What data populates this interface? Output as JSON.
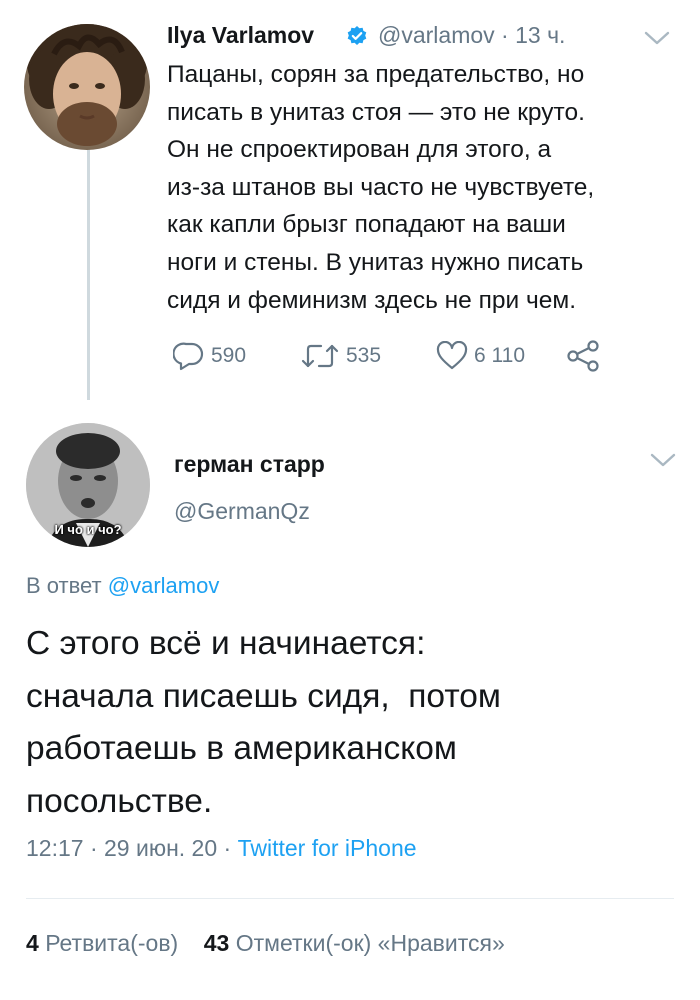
{
  "colors": {
    "accent": "#1da1f2",
    "secondary_text": "#657786",
    "primary_text": "#14171a",
    "thread_line": "#cfd9de"
  },
  "original_tweet": {
    "author_name": "Ilya Varlamov",
    "verified_icon": "verified-badge-icon",
    "handle_time": "@varlamov · 13 ч.",
    "text_lines": [
      "Пацаны, сорян за предательство, но",
      "писать в унитаз стоя — это не круто.",
      "Он не спроектирован для этого, а",
      "из-за штанов вы часто не чувствуете,",
      "как капли брызг попадают на ваши",
      "ноги и стены. В унитаз нужно писать",
      "сидя и феминизм здесь не при чем."
    ],
    "actions": {
      "reply_count": "590",
      "retweet_count": "535",
      "like_count": "6 110"
    }
  },
  "reply_tweet": {
    "avatar_caption": "И чо и чо?",
    "author_name": "герман старр",
    "handle": "@GermanQz",
    "reply_to_prefix": "В ответ",
    "reply_to_handle": "@varlamov",
    "text_lines": [
      "С этого всё и начинается:",
      "сначала писаешь сидя,  потом",
      "работаешь в американском",
      "посольстве."
    ],
    "time": "12:17 · 29 июн. 20 · ",
    "source": "Twitter for iPhone",
    "retweets_count": "4",
    "retweets_label": "Ретвита(-ов)",
    "likes_count": "43",
    "likes_label": "Отметки(-ок) «Нравится»"
  }
}
